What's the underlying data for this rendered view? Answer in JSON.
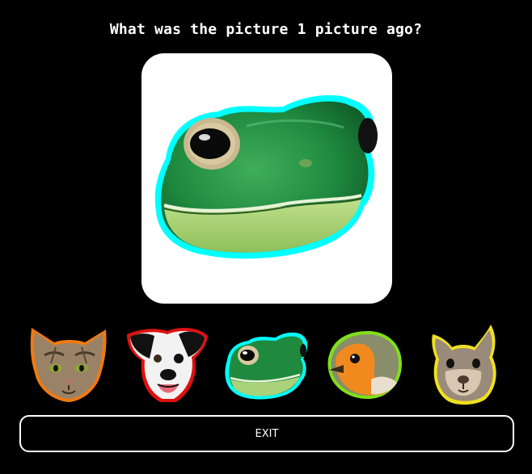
{
  "question": "What was the picture 1 picture ago?",
  "current_image": {
    "icon": "frog-head-icon",
    "outline_color": "#00ffff"
  },
  "choices": [
    {
      "icon": "cat-head-icon",
      "outline_color": "#f07a12"
    },
    {
      "icon": "dog-head-icon",
      "outline_color": "#e01010"
    },
    {
      "icon": "frog-head-icon",
      "outline_color": "#00ffff"
    },
    {
      "icon": "robin-head-icon",
      "outline_color": "#7fe01a"
    },
    {
      "icon": "squirrel-head-icon",
      "outline_color": "#f0e020"
    }
  ],
  "exit_label": "EXIT",
  "colors": {
    "background": "#000000",
    "card": "#ffffff",
    "button_border": "#ffffff"
  }
}
